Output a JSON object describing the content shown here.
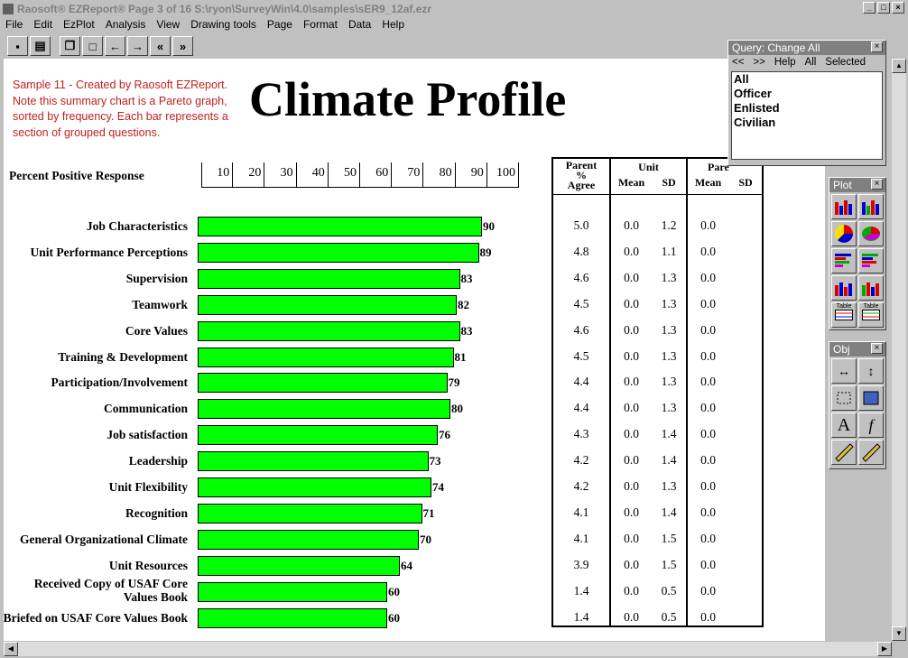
{
  "window": {
    "title": "Raosoft® EZReport® Page 3 of 16     S:\\ryon\\SurveyWin\\4.0\\samples\\sER9_12af.ezr"
  },
  "menu": [
    "File",
    "Edit",
    "EzPlot",
    "Analysis",
    "View",
    "Drawing tools",
    "Page",
    "Format",
    "Data",
    "Help"
  ],
  "report": {
    "note": "Sample 11 - Created by Raosoft EZReport. Note this summary chart is a Pareto graph, sorted by frequency. Each bar represents a section of grouped questions.",
    "title": "Climate Profile",
    "axis_label": "Percent Positive Response",
    "ticks": [
      "10",
      "20",
      "30",
      "40",
      "50",
      "60",
      "70",
      "80",
      "90",
      "100"
    ]
  },
  "chart_data": {
    "type": "bar",
    "orientation": "horizontal",
    "xlim": [
      0,
      100
    ],
    "categories": [
      "Job Characteristics",
      "Unit Performance Perceptions",
      "Supervision",
      "Teamwork",
      "Core Values",
      "Training  & Development",
      "Participation/Involvement",
      "Communication",
      "Job satisfaction",
      "Leadership",
      "Unit Flexibility",
      "Recognition",
      "General Organizational Climate",
      "Unit Resources",
      "Received Copy of USAF Core Values Book",
      "Briefed on USAF Core Values Book"
    ],
    "values": [
      90,
      89,
      83,
      82,
      83,
      81,
      79,
      80,
      76,
      73,
      74,
      71,
      70,
      64,
      60,
      60
    ],
    "colors": {
      "bar": "#00ff00"
    }
  },
  "table": {
    "headers": {
      "parent": "Parent",
      "pct": "%",
      "agree": "Agree",
      "unit": "Unit",
      "mean": "Mean",
      "sd": "SD",
      "pare": "Pare",
      "mean2": "Mean",
      "sd2": "SD"
    },
    "rows": [
      [
        "5.0",
        "0.0",
        "1.2",
        "0.0"
      ],
      [
        "4.8",
        "0.0",
        "1.1",
        "0.0"
      ],
      [
        "4.6",
        "0.0",
        "1.3",
        "0.0"
      ],
      [
        "4.5",
        "0.0",
        "1.3",
        "0.0"
      ],
      [
        "4.6",
        "0.0",
        "1.3",
        "0.0"
      ],
      [
        "4.5",
        "0.0",
        "1.3",
        "0.0"
      ],
      [
        "4.4",
        "0.0",
        "1.3",
        "0.0"
      ],
      [
        "4.4",
        "0.0",
        "1.3",
        "0.0"
      ],
      [
        "4.3",
        "0.0",
        "1.4",
        "0.0"
      ],
      [
        "4.2",
        "0.0",
        "1.4",
        "0.0"
      ],
      [
        "4.2",
        "0.0",
        "1.3",
        "0.0"
      ],
      [
        "4.1",
        "0.0",
        "1.4",
        "0.0"
      ],
      [
        "4.1",
        "0.0",
        "1.5",
        "0.0"
      ],
      [
        "3.9",
        "0.0",
        "1.5",
        "0.0"
      ],
      [
        "1.4",
        "0.0",
        "0.5",
        "0.0"
      ],
      [
        "1.4",
        "0.0",
        "0.5",
        "0.0"
      ]
    ]
  },
  "query_panel": {
    "title": "Query: Change All",
    "nav": [
      "<<",
      ">>",
      "Help",
      "All",
      "Selected"
    ],
    "items": [
      "All",
      "Officer",
      "Enlisted",
      "Civilian"
    ]
  },
  "plot_panel": {
    "title": "Plot",
    "table_label": "Table"
  },
  "obj_panel": {
    "title": "Obj",
    "text_tool": "A",
    "func_tool": "f"
  }
}
